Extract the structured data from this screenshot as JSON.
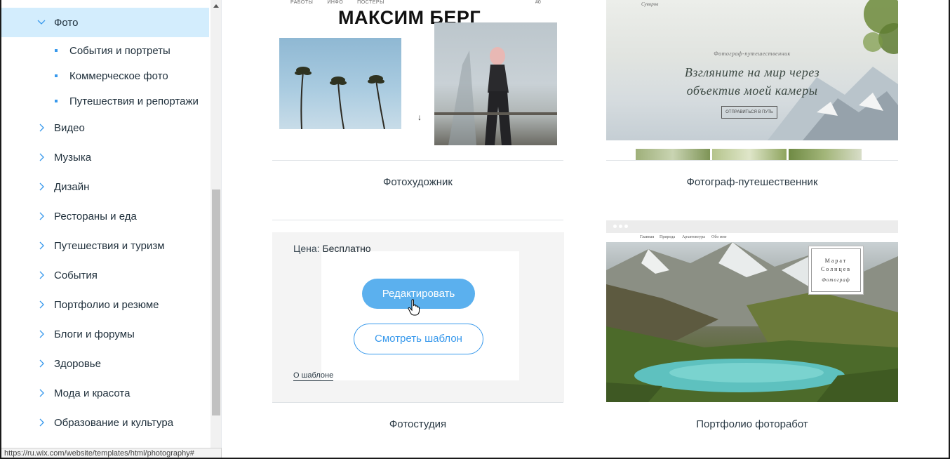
{
  "sidebar": {
    "items": [
      {
        "label": "Фото",
        "expanded": true,
        "active": true
      },
      {
        "label": "Видео"
      },
      {
        "label": "Музыка"
      },
      {
        "label": "Дизайн"
      },
      {
        "label": "Рестораны и еда"
      },
      {
        "label": "Путешествия и туризм"
      },
      {
        "label": "События"
      },
      {
        "label": "Портфолио и резюме"
      },
      {
        "label": "Блоги и форумы"
      },
      {
        "label": "Здоровье"
      },
      {
        "label": "Мода и красота"
      },
      {
        "label": "Образование и культура"
      }
    ],
    "subitems": [
      {
        "label": "События и портреты"
      },
      {
        "label": "Коммерческое фото"
      },
      {
        "label": "Путешествия и репортажи"
      }
    ]
  },
  "status_url": "https://ru.wix.com/website/templates/html/photography#",
  "templates": {
    "photo_artist": {
      "caption": "Фотохудожник",
      "preview": {
        "nav": [
          "РАБОТЫ",
          "ИНФО",
          "ПОСТЕРЫ"
        ],
        "cart": "#0",
        "title": "МАКСИМ БЕРГ"
      }
    },
    "travel_photographer": {
      "caption": "Фотограф-путешественник",
      "preview": {
        "brand": "Суворов",
        "tagline": "Фотограф-путешественник",
        "headline_line1": "Взгляните на мир через",
        "headline_line2": "объектив моей камеры",
        "button": "ОТПРАВИТЬСЯ В ПУТЬ"
      }
    },
    "photo_studio": {
      "caption": "Фотостудия",
      "price_label": "Цена:",
      "price_value": "Бесплатно",
      "edit_button": "Редактировать",
      "view_button": "Смотреть шаблон",
      "about_link": "О шаблоне"
    },
    "portfolio": {
      "caption": "Портфолио фоторабот",
      "preview": {
        "nav": [
          "Главная",
          "Природа",
          "Архитектура",
          "Обо мне"
        ],
        "name_line1": "Марат",
        "name_line2": "Солнцев",
        "role": "Фотограф"
      }
    }
  },
  "colors": {
    "accent": "#3899ec",
    "edit_button": "#5bb0ee",
    "active_item_bg": "#d3edfd",
    "bullet": "#3899ec"
  },
  "icons": {
    "collapse": "chevron-down-icon",
    "expand": "chevron-right-icon",
    "cursor": "hand-pointer-icon"
  }
}
